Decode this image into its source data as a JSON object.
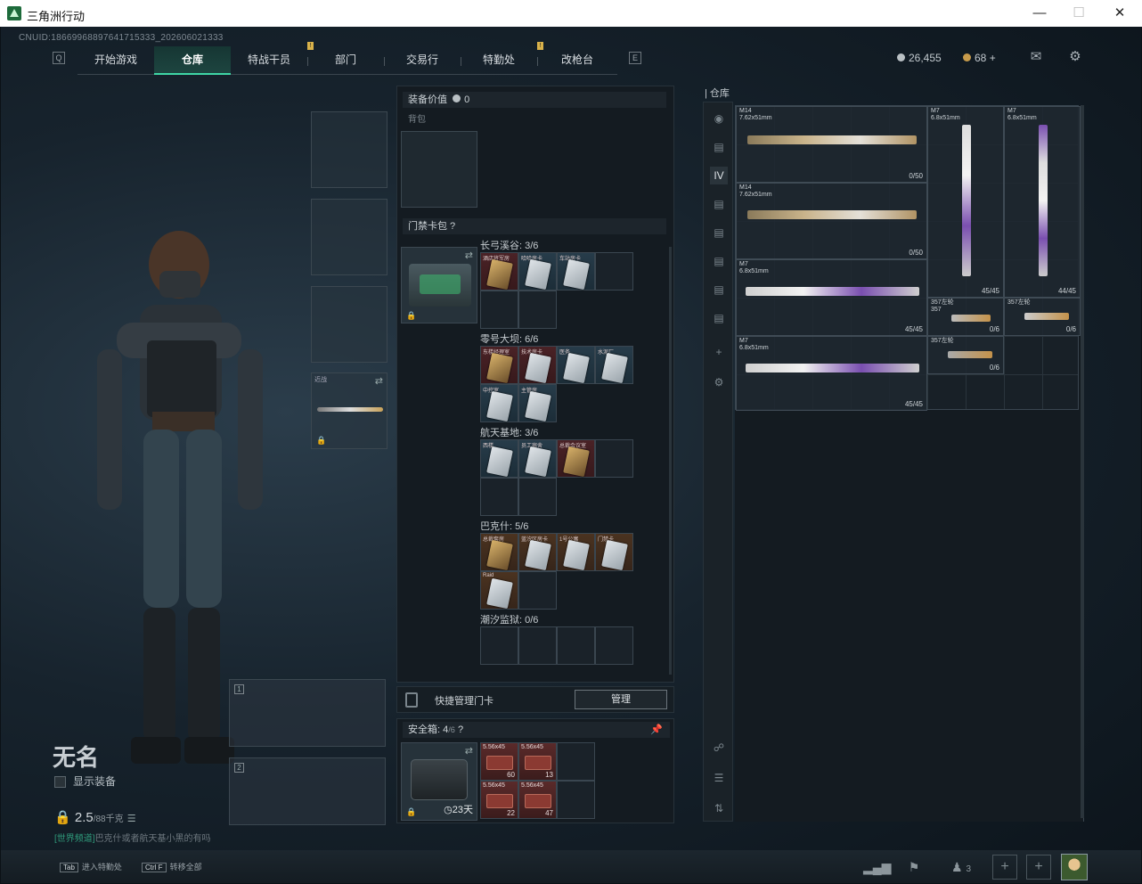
{
  "window": {
    "title": "三角洲行动"
  },
  "uid": "CNUID:18669968897641715333_202606021333",
  "nav": {
    "tabs": [
      "开始游戏",
      "仓库",
      "特战干员",
      "部门",
      "交易行",
      "特勤处",
      "改枪台"
    ],
    "active": "仓库",
    "left_key": "Q",
    "right_key": "E"
  },
  "currency": {
    "silver": "26,455",
    "gold": "68"
  },
  "player": {
    "name": "无名",
    "show_equipment": "显示装备",
    "weight": "2.5",
    "weight_max": "/88千克",
    "chat_channel": "[世界频道]",
    "chat_text": "巴克什或者航天基小黑的有吗"
  },
  "equip_panel": {
    "equipment_value_label": "装备价值",
    "equipment_value": "0",
    "backpack_label": "背包",
    "keycard_pack_label": "门禁卡包",
    "melee_label": "近战",
    "card_sets": [
      {
        "name": "长弓溪谷: 3/6"
      },
      {
        "name": "零号大坝: 6/6"
      },
      {
        "name": "航天基地: 3/6"
      },
      {
        "name": "巴克什: 5/6"
      },
      {
        "name": "潮汐监狱: 0/6"
      }
    ],
    "card_captions": {
      "s1": [
        "酒店将军房",
        "哈哈房卡",
        "车站房卡"
      ],
      "s2": [
        "东楼经理室",
        "技术房卡",
        "医务",
        "水泥厂",
        "中控室",
        "主管房"
      ],
      "s3": [
        "西楼",
        "员工宿舍",
        "总裁会议室"
      ],
      "s4": [
        "总裁套房",
        "蓝汐区房卡",
        "1号公寓",
        "门禁卡",
        "Raid"
      ]
    },
    "quick_manage_label": "快捷管理门卡",
    "manage_button": "管理"
  },
  "safe_box": {
    "label": "安全箱:",
    "capacity": "4",
    "capacity_max": "/6",
    "days": "23天",
    "ammo": [
      {
        "caliber": "5.56x45",
        "count": "60"
      },
      {
        "caliber": "5.56x45",
        "count": "13"
      },
      {
        "caliber": "5.56x45",
        "count": "22"
      },
      {
        "caliber": "5.56x45",
        "count": "47"
      }
    ]
  },
  "warehouse": {
    "title": "仓库",
    "items": [
      {
        "name": "M14\n7.62x51mm",
        "ammo": "0/50"
      },
      {
        "name": "M14\n7.62x51mm",
        "ammo": "0/50"
      },
      {
        "name": "M7\n6.8x51mm",
        "ammo": "45/45"
      },
      {
        "name": "M7\n6.8x51mm",
        "ammo": "44/45"
      },
      {
        "name": "M7\n6.8x51mm",
        "ammo": "45/45"
      },
      {
        "name": "M7\n6.8x51mm",
        "ammo": "45/45"
      },
      {
        "name": "357左轮\n357",
        "ammo": "0/6"
      },
      {
        "name": "357左轮",
        "ammo": "0/6"
      },
      {
        "name": "357左轮",
        "ammo": "0/6"
      }
    ],
    "tab_badge": "IV"
  },
  "bottom": {
    "hint1_key": "Tab",
    "hint1": "进入特勤处",
    "hint2_key": "Ctrl F",
    "hint2": "转移全部",
    "friends_count": "3"
  },
  "colors": {
    "accent": "#3fd6a6",
    "gold": "#c79b4b",
    "red_slot": "#4a2226"
  }
}
